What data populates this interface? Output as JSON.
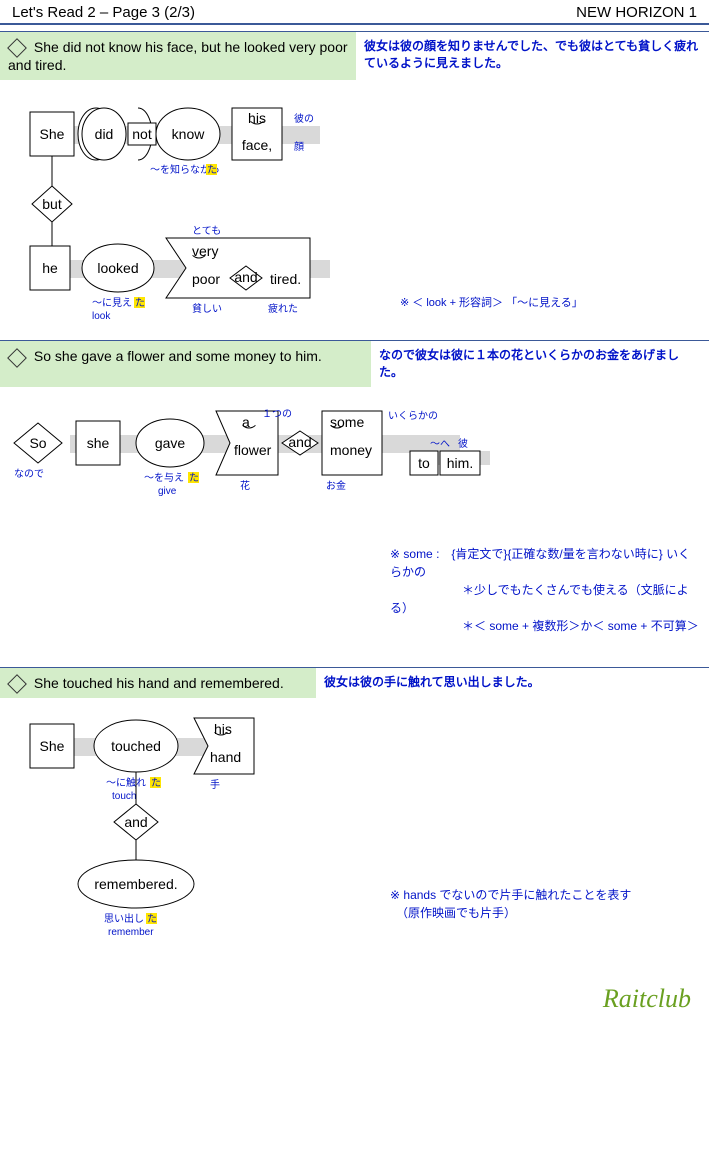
{
  "header": {
    "left": "Let's Read 2 – Page 3 (2/3)",
    "right": "NEW HORIZON 1"
  },
  "sections": [
    {
      "sentence": "She did not know his face, but he looked very poor and tired.",
      "translation": "彼女は彼の顔を知りませんでした、でも彼はとても貧しく疲れているように見えました。",
      "diagram": {
        "she": "She",
        "did": "did",
        "not": "not",
        "know": "know",
        "his": "his",
        "face": "face,",
        "but": "but",
        "he": "he",
        "looked": "looked",
        "very": "very",
        "poor": "poor",
        "and": "and",
        "tired": "tired.",
        "jp_know": "〜を知らなかっ",
        "jp_know_ta": "た",
        "jp_his": "彼の",
        "jp_face": "顔",
        "jp_looked": "〜に見え",
        "jp_looked_ta": "た",
        "jp_look": "look",
        "jp_very": "とても",
        "jp_poor": "貧しい",
        "jp_tired": "疲れた"
      },
      "side_note": "※ ＜ look + 形容詞＞ 「〜に見える」"
    },
    {
      "sentence": "So she gave a flower and some money to him.",
      "translation": "なので彼女は彼に１本の花といくらかのお金をあげました。",
      "diagram": {
        "so": "So",
        "she": "she",
        "gave": "gave",
        "a": "a",
        "flower": "flower",
        "and": "and",
        "some": "some",
        "money": "money",
        "to": "to",
        "him": "him.",
        "jp_so": "なので",
        "jp_gave": "〜を与え",
        "jp_gave_ta": "た",
        "jp_give": "give",
        "jp_a": "１つの",
        "jp_flower": "花",
        "jp_some": "いくらかの",
        "jp_money": "お金",
        "jp_to": "〜へ",
        "jp_him": "彼"
      },
      "side_note": "※ some :　{肯定文で}{正確な数/量を言わない時に} いくらかの\n　　　　　　＊少しでもたくさんでも使える（文脈による）\n　　　　　　＊＜ some + 複数形＞か＜ some + 不可算＞"
    },
    {
      "sentence": "She touched his hand and remembered.",
      "translation": "彼女は彼の手に触れて思い出しました。",
      "diagram": {
        "she": "She",
        "touched": "touched",
        "his": "his",
        "hand": "hand",
        "and": "and",
        "remembered": "remembered.",
        "jp_touched": "〜に触れ",
        "jp_touched_ta": "た",
        "jp_touch": "touch",
        "jp_his": "彼の",
        "jp_hand": "手",
        "jp_remembered": "思い出し",
        "jp_remembered_ta": "た",
        "jp_remember": "remember"
      },
      "side_note": "※ hands でないので片手に触れたことを表す\n　（原作映画でも片手）"
    }
  ],
  "watermark": "Raitclub"
}
